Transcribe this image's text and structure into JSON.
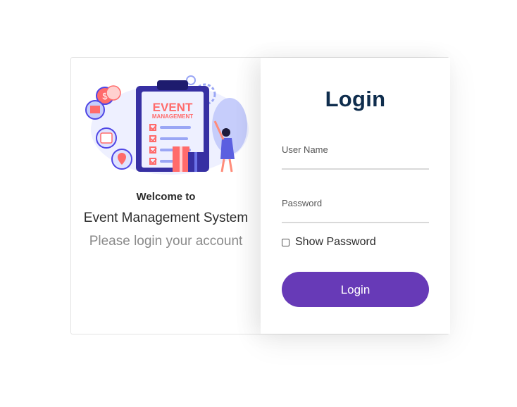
{
  "left": {
    "illustration_text_line1": "EVENT",
    "illustration_text_line2": "MANAGEMENT",
    "welcome": "Welcome to",
    "system_name": "Event Management System",
    "subtitle": "Please login your account"
  },
  "form": {
    "title": "Login",
    "username_label": "User Name",
    "password_label": "Password",
    "show_password_label": "Show Password",
    "submit_label": "Login"
  },
  "colors": {
    "primary": "#673ab7",
    "title": "#0f2d4d"
  }
}
